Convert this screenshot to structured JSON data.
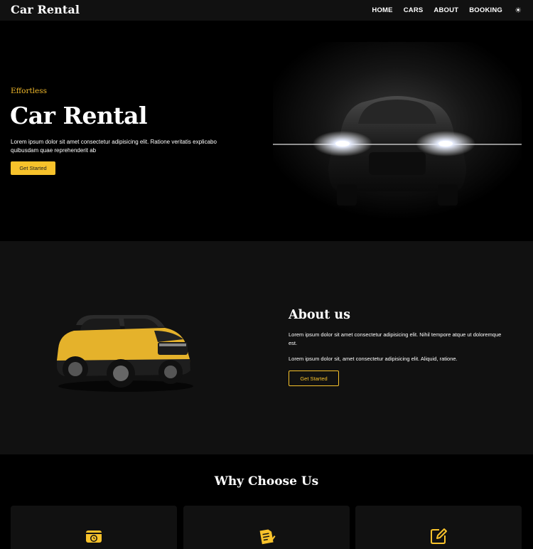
{
  "nav": {
    "logo": "Car Rental",
    "items": [
      "HOME",
      "CARS",
      "ABOUT",
      "BOOKING"
    ],
    "theme_icon": "sun-icon"
  },
  "hero": {
    "tag": "Effortless",
    "title": "Car Rental",
    "text": "Lorem ipsum dolor sit amet consectetur adipisicing elit. Ratione veritatis explicabo quibusdam quae reprehenderit ab",
    "button": "Get Started"
  },
  "about": {
    "title": "About us",
    "p1": "Lorem ipsum dolor sit amet consectetur adipisicing elit. Nihil tempore atque ut doloremque est.",
    "p2": "Lorem ipsum dolor sit, amet consectetur adipisicing elit. Aliquid, ratione.",
    "button": "Get Started"
  },
  "why": {
    "title": "Why Choose Us",
    "cards": [
      {
        "icon": "wallet-clock-icon"
      },
      {
        "icon": "document-pen-icon"
      },
      {
        "icon": "edit-icon"
      }
    ]
  },
  "colors": {
    "accent": "#f7c22b",
    "bg_dark": "#000000",
    "bg_panel": "#111111"
  }
}
